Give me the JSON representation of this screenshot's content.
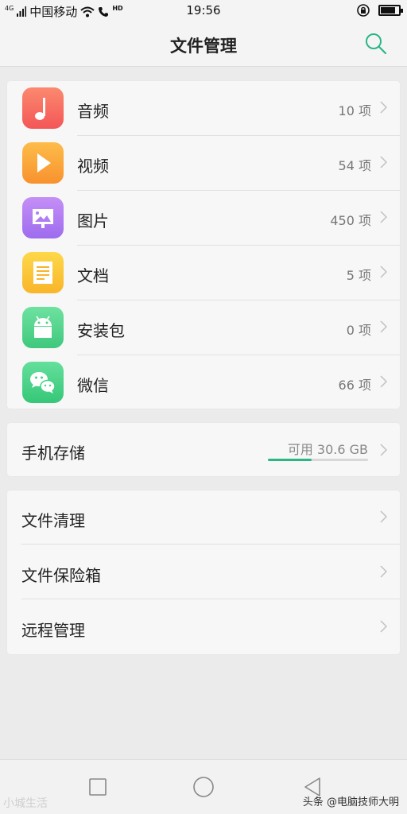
{
  "status_bar": {
    "signal_tag": "4G",
    "carrier": "中国移动",
    "hd": "HD",
    "time": "19:56"
  },
  "header": {
    "title": "文件管理",
    "search_icon": "search-icon"
  },
  "categories": [
    {
      "label": "音频",
      "count": "10 项",
      "icon": "music-note-icon",
      "color": "#f66a5a"
    },
    {
      "label": "视频",
      "count": "54 项",
      "icon": "play-icon",
      "color": "#fba33a"
    },
    {
      "label": "图片",
      "count": "450 项",
      "icon": "image-icon",
      "color": "#b07df2"
    },
    {
      "label": "文档",
      "count": "5 项",
      "icon": "document-icon",
      "color": "#fbc530"
    },
    {
      "label": "安装包",
      "count": "0 项",
      "icon": "android-icon",
      "color": "#4fd28a"
    },
    {
      "label": "微信",
      "count": "66 项",
      "icon": "wechat-icon",
      "color": "#43d184"
    }
  ],
  "storage": {
    "label": "手机存储",
    "available": "可用 30.6 GB",
    "used_fraction": 0.44,
    "bar_color": "#2ab783"
  },
  "tools": [
    {
      "label": "文件清理"
    },
    {
      "label": "文件保险箱"
    },
    {
      "label": "远程管理"
    }
  ],
  "nav": {
    "recent_icon": "square-icon",
    "home_icon": "circle-icon",
    "back_icon": "triangle-back-icon"
  },
  "watermarks": {
    "left": "小城生活",
    "right": "头条 @电脑技师大明"
  }
}
